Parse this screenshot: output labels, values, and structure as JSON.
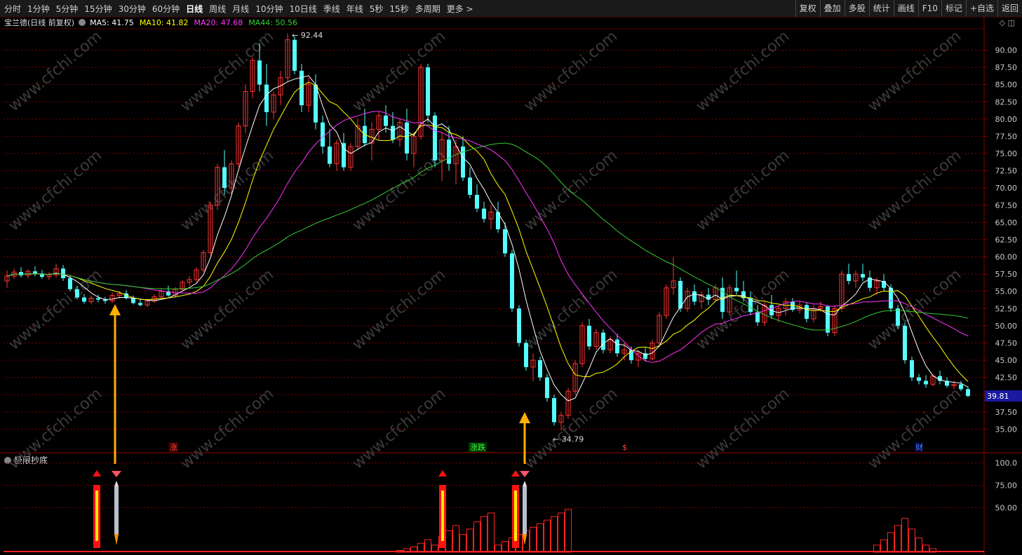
{
  "toolbar": {
    "periods": [
      "分时",
      "1分钟",
      "5分钟",
      "15分钟",
      "30分钟",
      "60分钟",
      "日线",
      "周线",
      "月线",
      "10分钟",
      "10日线",
      "季线",
      "年线",
      "5秒",
      "15秒",
      "多周期",
      "更多 >"
    ],
    "active_period": "日线",
    "actions": [
      "复权",
      "叠加",
      "多股",
      "统计",
      "画线",
      "F10",
      "标记",
      "+自选",
      "返回"
    ]
  },
  "legend": {
    "symbol": "宝兰德(日线 前复权)",
    "ma5": "MA5: 41.75",
    "ma10": "MA10: 41.82",
    "ma20": "MA20: 47.68",
    "ma44": "MA44: 50.56"
  },
  "colors": {
    "up": "#ff3333",
    "down": "#54ffff",
    "ma5": "#ffffff",
    "ma10": "#ffff00",
    "ma20": "#ff33ff",
    "ma44": "#33cc33",
    "grid": "#800000",
    "arrow": "#ffb000"
  },
  "main_chart": {
    "y_ticks": [
      "90.00",
      "87.50",
      "85.00",
      "82.50",
      "80.00",
      "77.50",
      "75.00",
      "72.50",
      "70.00",
      "67.50",
      "65.00",
      "62.50",
      "60.00",
      "57.50",
      "55.00",
      "52.50",
      "50.00",
      "47.50",
      "45.00",
      "42.50",
      "40.00",
      "37.50",
      "35.00"
    ],
    "current_price": "39.81",
    "high_label": "92.44",
    "low_label": "34.79",
    "markers": [
      "涨",
      "涨跌",
      "$",
      "财"
    ]
  },
  "sub_chart": {
    "title": "极限抄底",
    "y_ticks": [
      "100.0",
      "75.00",
      "50.00"
    ]
  },
  "watermark": "www.cfchi.com",
  "chart_data": {
    "type": "candlestick",
    "ylim": [
      33,
      93
    ],
    "ohlc": [
      [
        56.5,
        58.0,
        55.5,
        57.2
      ],
      [
        57.2,
        58.3,
        56.8,
        57.8
      ],
      [
        57.8,
        58.5,
        57.0,
        57.3
      ],
      [
        57.3,
        58.2,
        56.9,
        57.9
      ],
      [
        57.9,
        58.6,
        57.2,
        57.5
      ],
      [
        57.5,
        58.1,
        56.8,
        57.1
      ],
      [
        57.1,
        57.8,
        56.6,
        57.4
      ],
      [
        57.4,
        59.0,
        57.0,
        58.3
      ],
      [
        58.3,
        58.8,
        56.5,
        56.9
      ],
      [
        56.9,
        57.3,
        55.0,
        55.3
      ],
      [
        55.3,
        55.8,
        53.8,
        54.1
      ],
      [
        54.1,
        54.6,
        53.2,
        53.5
      ],
      [
        53.5,
        54.4,
        53.1,
        54.0
      ],
      [
        54.0,
        54.5,
        53.4,
        53.8
      ],
      [
        53.8,
        54.2,
        53.2,
        53.6
      ],
      [
        53.6,
        54.8,
        53.3,
        54.4
      ],
      [
        54.4,
        55.0,
        53.9,
        54.7
      ],
      [
        54.7,
        55.2,
        53.8,
        54.0
      ],
      [
        54.0,
        54.4,
        53.1,
        53.3
      ],
      [
        53.3,
        53.8,
        52.8,
        53.0
      ],
      [
        53.0,
        53.9,
        52.7,
        53.6
      ],
      [
        53.6,
        54.6,
        53.3,
        54.2
      ],
      [
        54.2,
        55.3,
        53.9,
        55.0
      ],
      [
        55.0,
        55.8,
        54.2,
        54.4
      ],
      [
        54.4,
        55.6,
        54.1,
        55.3
      ],
      [
        55.3,
        56.6,
        55.0,
        56.3
      ],
      [
        56.3,
        57.2,
        55.8,
        56.7
      ],
      [
        56.7,
        58.5,
        56.3,
        58.1
      ],
      [
        58.1,
        61.0,
        57.8,
        60.6
      ],
      [
        60.6,
        68.0,
        60.2,
        67.5
      ],
      [
        67.5,
        73.5,
        66.8,
        73.0
      ],
      [
        73.0,
        75.5,
        69.0,
        70.0
      ],
      [
        70.0,
        74.0,
        69.0,
        73.5
      ],
      [
        73.5,
        79.5,
        73.0,
        79.0
      ],
      [
        79.0,
        85.0,
        78.0,
        84.0
      ],
      [
        84.0,
        89.0,
        83.0,
        88.5
      ],
      [
        88.5,
        91.0,
        84.0,
        85.0
      ],
      [
        85.0,
        88.0,
        79.0,
        81.0
      ],
      [
        81.0,
        84.0,
        80.0,
        83.5
      ],
      [
        83.5,
        87.0,
        82.0,
        86.0
      ],
      [
        86.0,
        92.4,
        85.5,
        91.5
      ],
      [
        91.5,
        92.0,
        86.5,
        87.0
      ],
      [
        87.0,
        88.0,
        81.0,
        82.0
      ],
      [
        82.0,
        86.0,
        81.0,
        85.0
      ],
      [
        85.0,
        86.5,
        78.5,
        79.5
      ],
      [
        79.5,
        80.5,
        75.0,
        76.0
      ],
      [
        76.0,
        78.5,
        73.0,
        73.5
      ],
      [
        73.5,
        77.0,
        72.5,
        76.5
      ],
      [
        76.5,
        78.0,
        72.5,
        73.0
      ],
      [
        73.0,
        76.5,
        72.5,
        76.0
      ],
      [
        76.0,
        80.0,
        75.5,
        79.0
      ],
      [
        79.0,
        81.5,
        76.0,
        76.5
      ],
      [
        76.5,
        79.5,
        74.0,
        78.5
      ],
      [
        78.5,
        81.0,
        77.0,
        80.5
      ],
      [
        80.5,
        82.0,
        78.0,
        79.0
      ],
      [
        79.0,
        81.0,
        76.5,
        77.0
      ],
      [
        77.0,
        80.0,
        76.0,
        79.5
      ],
      [
        79.5,
        81.5,
        74.0,
        75.0
      ],
      [
        75.0,
        78.0,
        73.0,
        77.5
      ],
      [
        77.5,
        88.0,
        77.0,
        87.5
      ],
      [
        87.5,
        88.0,
        79.5,
        80.5
      ],
      [
        80.5,
        81.0,
        73.0,
        74.0
      ],
      [
        74.0,
        78.0,
        71.0,
        77.0
      ],
      [
        77.0,
        79.0,
        72.5,
        73.5
      ],
      [
        73.5,
        77.0,
        70.5,
        76.0
      ],
      [
        76.0,
        77.5,
        71.0,
        71.5
      ],
      [
        71.5,
        73.0,
        68.5,
        69.0
      ],
      [
        69.0,
        70.5,
        66.5,
        67.0
      ],
      [
        67.0,
        68.0,
        65.0,
        65.5
      ],
      [
        65.5,
        67.5,
        64.0,
        66.5
      ],
      [
        66.5,
        68.0,
        63.5,
        64.0
      ],
      [
        64.0,
        65.0,
        60.0,
        60.5
      ],
      [
        60.5,
        61.0,
        52.0,
        52.5
      ],
      [
        52.5,
        53.0,
        47.0,
        47.5
      ],
      [
        47.5,
        48.0,
        43.5,
        44.0
      ],
      [
        44.0,
        46.0,
        42.0,
        45.0
      ],
      [
        45.0,
        45.5,
        42.0,
        42.5
      ],
      [
        42.5,
        43.0,
        39.0,
        39.5
      ],
      [
        39.5,
        40.0,
        35.5,
        36.0
      ],
      [
        36.0,
        37.5,
        34.8,
        37.0
      ],
      [
        37.0,
        41.0,
        36.5,
        40.5
      ],
      [
        40.5,
        45.0,
        40.0,
        44.5
      ],
      [
        44.5,
        50.5,
        44.0,
        50.0
      ],
      [
        50.0,
        51.0,
        46.5,
        47.0
      ],
      [
        47.0,
        49.5,
        46.5,
        49.0
      ],
      [
        49.0,
        49.5,
        46.0,
        46.5
      ],
      [
        46.5,
        48.5,
        46.0,
        48.0
      ],
      [
        48.0,
        48.8,
        45.5,
        46.0
      ],
      [
        46.0,
        47.5,
        45.0,
        46.5
      ],
      [
        46.5,
        47.0,
        44.5,
        45.0
      ],
      [
        45.0,
        46.5,
        44.0,
        46.0
      ],
      [
        46.0,
        46.8,
        44.8,
        45.2
      ],
      [
        45.2,
        48.0,
        45.0,
        47.5
      ],
      [
        47.5,
        52.0,
        47.0,
        51.5
      ],
      [
        51.5,
        56.0,
        51.0,
        55.5
      ],
      [
        55.5,
        60.0,
        54.5,
        56.5
      ],
      [
        56.5,
        57.0,
        52.0,
        52.5
      ],
      [
        52.5,
        55.5,
        52.0,
        55.0
      ],
      [
        55.0,
        56.0,
        53.0,
        53.5
      ],
      [
        53.5,
        55.0,
        52.5,
        54.5
      ],
      [
        54.5,
        55.5,
        53.0,
        53.8
      ],
      [
        53.8,
        56.0,
        53.5,
        55.5
      ],
      [
        55.5,
        57.0,
        51.0,
        52.0
      ],
      [
        52.0,
        56.0,
        51.5,
        55.5
      ],
      [
        55.5,
        58.0,
        54.5,
        55.0
      ],
      [
        55.0,
        56.5,
        53.5,
        54.0
      ],
      [
        54.0,
        55.0,
        51.5,
        52.0
      ],
      [
        52.0,
        53.0,
        50.0,
        50.5
      ],
      [
        50.5,
        53.5,
        50.0,
        53.0
      ],
      [
        53.0,
        54.5,
        51.0,
        51.5
      ],
      [
        51.5,
        53.0,
        50.5,
        52.5
      ],
      [
        52.5,
        54.0,
        51.5,
        53.5
      ],
      [
        53.5,
        54.0,
        52.0,
        52.3
      ],
      [
        52.3,
        53.5,
        51.8,
        53.0
      ],
      [
        53.0,
        53.3,
        50.5,
        51.0
      ],
      [
        51.0,
        53.0,
        50.5,
        52.5
      ],
      [
        52.5,
        53.5,
        52.0,
        52.8
      ],
      [
        52.8,
        53.0,
        48.5,
        49.0
      ],
      [
        49.0,
        53.0,
        48.5,
        52.5
      ],
      [
        52.5,
        58.0,
        52.0,
        57.5
      ],
      [
        57.5,
        59.0,
        56.0,
        56.5
      ],
      [
        56.5,
        58.0,
        55.5,
        57.5
      ],
      [
        57.5,
        59.0,
        56.5,
        57.0
      ],
      [
        57.0,
        58.0,
        55.0,
        55.5
      ],
      [
        55.5,
        57.0,
        54.5,
        56.5
      ],
      [
        56.5,
        57.5,
        55.0,
        55.5
      ],
      [
        55.5,
        56.0,
        52.0,
        52.5
      ],
      [
        52.5,
        53.0,
        49.5,
        50.0
      ],
      [
        50.0,
        50.5,
        44.5,
        45.0
      ],
      [
        45.0,
        45.5,
        42.0,
        42.5
      ],
      [
        42.5,
        43.0,
        41.5,
        42.0
      ],
      [
        42.0,
        42.8,
        41.0,
        41.5
      ],
      [
        41.5,
        43.0,
        41.2,
        42.7
      ],
      [
        42.7,
        43.5,
        41.5,
        42.0
      ],
      [
        42.0,
        42.5,
        41.0,
        41.3
      ],
      [
        41.3,
        42.0,
        40.8,
        41.5
      ],
      [
        41.5,
        42.0,
        40.5,
        40.8
      ],
      [
        40.8,
        41.2,
        39.6,
        39.81
      ]
    ]
  }
}
